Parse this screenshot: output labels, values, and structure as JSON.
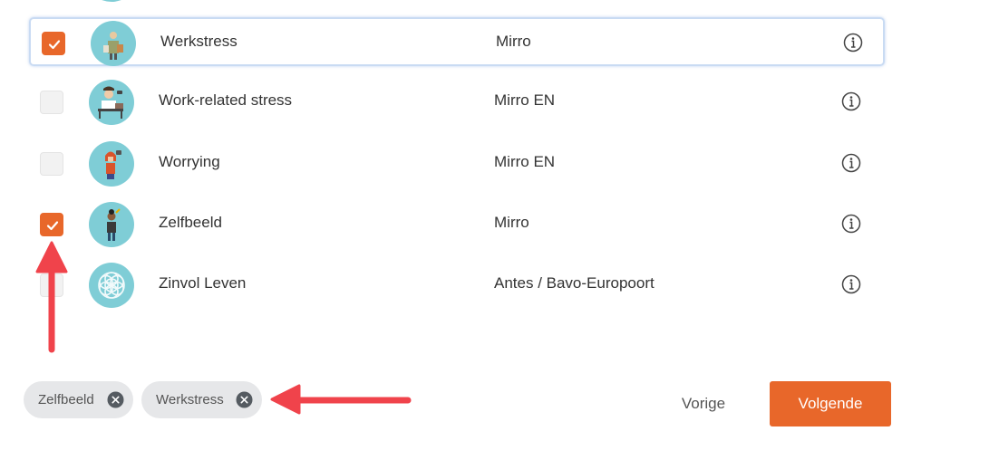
{
  "programs": [
    {
      "name": "Werkstress",
      "source": "Mirro",
      "checked": true,
      "focused": true,
      "avatar_icon": "person-with-folders-icon"
    },
    {
      "name": "Work-related stress",
      "source": "Mirro EN",
      "checked": false,
      "focused": false,
      "avatar_icon": "person-at-desk-icon"
    },
    {
      "name": "Worrying",
      "source": "Mirro EN",
      "checked": false,
      "focused": false,
      "avatar_icon": "worried-person-icon"
    },
    {
      "name": "Zelfbeeld",
      "source": "Mirro",
      "checked": true,
      "focused": false,
      "avatar_icon": "person-standing-icon"
    },
    {
      "name": "Zinvol Leven",
      "source": "Antes / Bavo-Europoort",
      "checked": false,
      "focused": false,
      "avatar_icon": "flower-of-life-icon"
    }
  ],
  "selected_chips": [
    {
      "label": "Zelfbeeld"
    },
    {
      "label": "Werkstress"
    }
  ],
  "navigation": {
    "prev_label": "Vorige",
    "next_label": "Volgende"
  },
  "colors": {
    "accent": "#e8672a",
    "avatar_bg": "#7fcdd6",
    "annotation_arrow": "#f0434b",
    "chip_bg": "#e6e7e9"
  }
}
